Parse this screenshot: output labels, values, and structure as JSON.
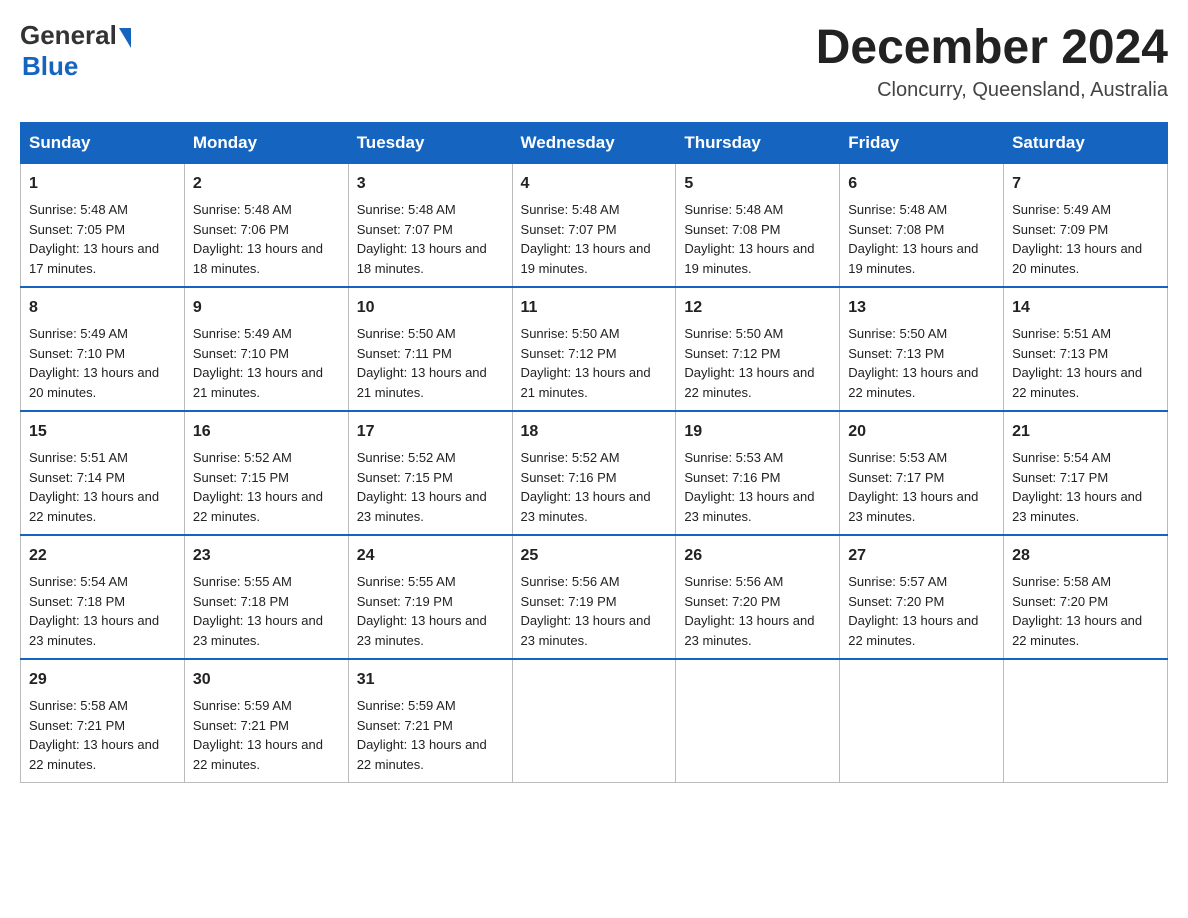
{
  "header": {
    "logo_general": "General",
    "logo_blue": "Blue",
    "title": "December 2024",
    "location": "Cloncurry, Queensland, Australia"
  },
  "weekdays": [
    "Sunday",
    "Monday",
    "Tuesday",
    "Wednesday",
    "Thursday",
    "Friday",
    "Saturday"
  ],
  "weeks": [
    [
      {
        "day": "1",
        "sunrise": "5:48 AM",
        "sunset": "7:05 PM",
        "daylight": "13 hours and 17 minutes."
      },
      {
        "day": "2",
        "sunrise": "5:48 AM",
        "sunset": "7:06 PM",
        "daylight": "13 hours and 18 minutes."
      },
      {
        "day": "3",
        "sunrise": "5:48 AM",
        "sunset": "7:07 PM",
        "daylight": "13 hours and 18 minutes."
      },
      {
        "day": "4",
        "sunrise": "5:48 AM",
        "sunset": "7:07 PM",
        "daylight": "13 hours and 19 minutes."
      },
      {
        "day": "5",
        "sunrise": "5:48 AM",
        "sunset": "7:08 PM",
        "daylight": "13 hours and 19 minutes."
      },
      {
        "day": "6",
        "sunrise": "5:48 AM",
        "sunset": "7:08 PM",
        "daylight": "13 hours and 19 minutes."
      },
      {
        "day": "7",
        "sunrise": "5:49 AM",
        "sunset": "7:09 PM",
        "daylight": "13 hours and 20 minutes."
      }
    ],
    [
      {
        "day": "8",
        "sunrise": "5:49 AM",
        "sunset": "7:10 PM",
        "daylight": "13 hours and 20 minutes."
      },
      {
        "day": "9",
        "sunrise": "5:49 AM",
        "sunset": "7:10 PM",
        "daylight": "13 hours and 21 minutes."
      },
      {
        "day": "10",
        "sunrise": "5:50 AM",
        "sunset": "7:11 PM",
        "daylight": "13 hours and 21 minutes."
      },
      {
        "day": "11",
        "sunrise": "5:50 AM",
        "sunset": "7:12 PM",
        "daylight": "13 hours and 21 minutes."
      },
      {
        "day": "12",
        "sunrise": "5:50 AM",
        "sunset": "7:12 PM",
        "daylight": "13 hours and 22 minutes."
      },
      {
        "day": "13",
        "sunrise": "5:50 AM",
        "sunset": "7:13 PM",
        "daylight": "13 hours and 22 minutes."
      },
      {
        "day": "14",
        "sunrise": "5:51 AM",
        "sunset": "7:13 PM",
        "daylight": "13 hours and 22 minutes."
      }
    ],
    [
      {
        "day": "15",
        "sunrise": "5:51 AM",
        "sunset": "7:14 PM",
        "daylight": "13 hours and 22 minutes."
      },
      {
        "day": "16",
        "sunrise": "5:52 AM",
        "sunset": "7:15 PM",
        "daylight": "13 hours and 22 minutes."
      },
      {
        "day": "17",
        "sunrise": "5:52 AM",
        "sunset": "7:15 PM",
        "daylight": "13 hours and 23 minutes."
      },
      {
        "day": "18",
        "sunrise": "5:52 AM",
        "sunset": "7:16 PM",
        "daylight": "13 hours and 23 minutes."
      },
      {
        "day": "19",
        "sunrise": "5:53 AM",
        "sunset": "7:16 PM",
        "daylight": "13 hours and 23 minutes."
      },
      {
        "day": "20",
        "sunrise": "5:53 AM",
        "sunset": "7:17 PM",
        "daylight": "13 hours and 23 minutes."
      },
      {
        "day": "21",
        "sunrise": "5:54 AM",
        "sunset": "7:17 PM",
        "daylight": "13 hours and 23 minutes."
      }
    ],
    [
      {
        "day": "22",
        "sunrise": "5:54 AM",
        "sunset": "7:18 PM",
        "daylight": "13 hours and 23 minutes."
      },
      {
        "day": "23",
        "sunrise": "5:55 AM",
        "sunset": "7:18 PM",
        "daylight": "13 hours and 23 minutes."
      },
      {
        "day": "24",
        "sunrise": "5:55 AM",
        "sunset": "7:19 PM",
        "daylight": "13 hours and 23 minutes."
      },
      {
        "day": "25",
        "sunrise": "5:56 AM",
        "sunset": "7:19 PM",
        "daylight": "13 hours and 23 minutes."
      },
      {
        "day": "26",
        "sunrise": "5:56 AM",
        "sunset": "7:20 PM",
        "daylight": "13 hours and 23 minutes."
      },
      {
        "day": "27",
        "sunrise": "5:57 AM",
        "sunset": "7:20 PM",
        "daylight": "13 hours and 22 minutes."
      },
      {
        "day": "28",
        "sunrise": "5:58 AM",
        "sunset": "7:20 PM",
        "daylight": "13 hours and 22 minutes."
      }
    ],
    [
      {
        "day": "29",
        "sunrise": "5:58 AM",
        "sunset": "7:21 PM",
        "daylight": "13 hours and 22 minutes."
      },
      {
        "day": "30",
        "sunrise": "5:59 AM",
        "sunset": "7:21 PM",
        "daylight": "13 hours and 22 minutes."
      },
      {
        "day": "31",
        "sunrise": "5:59 AM",
        "sunset": "7:21 PM",
        "daylight": "13 hours and 22 minutes."
      },
      null,
      null,
      null,
      null
    ]
  ],
  "labels": {
    "sunrise": "Sunrise:",
    "sunset": "Sunset:",
    "daylight": "Daylight:"
  }
}
